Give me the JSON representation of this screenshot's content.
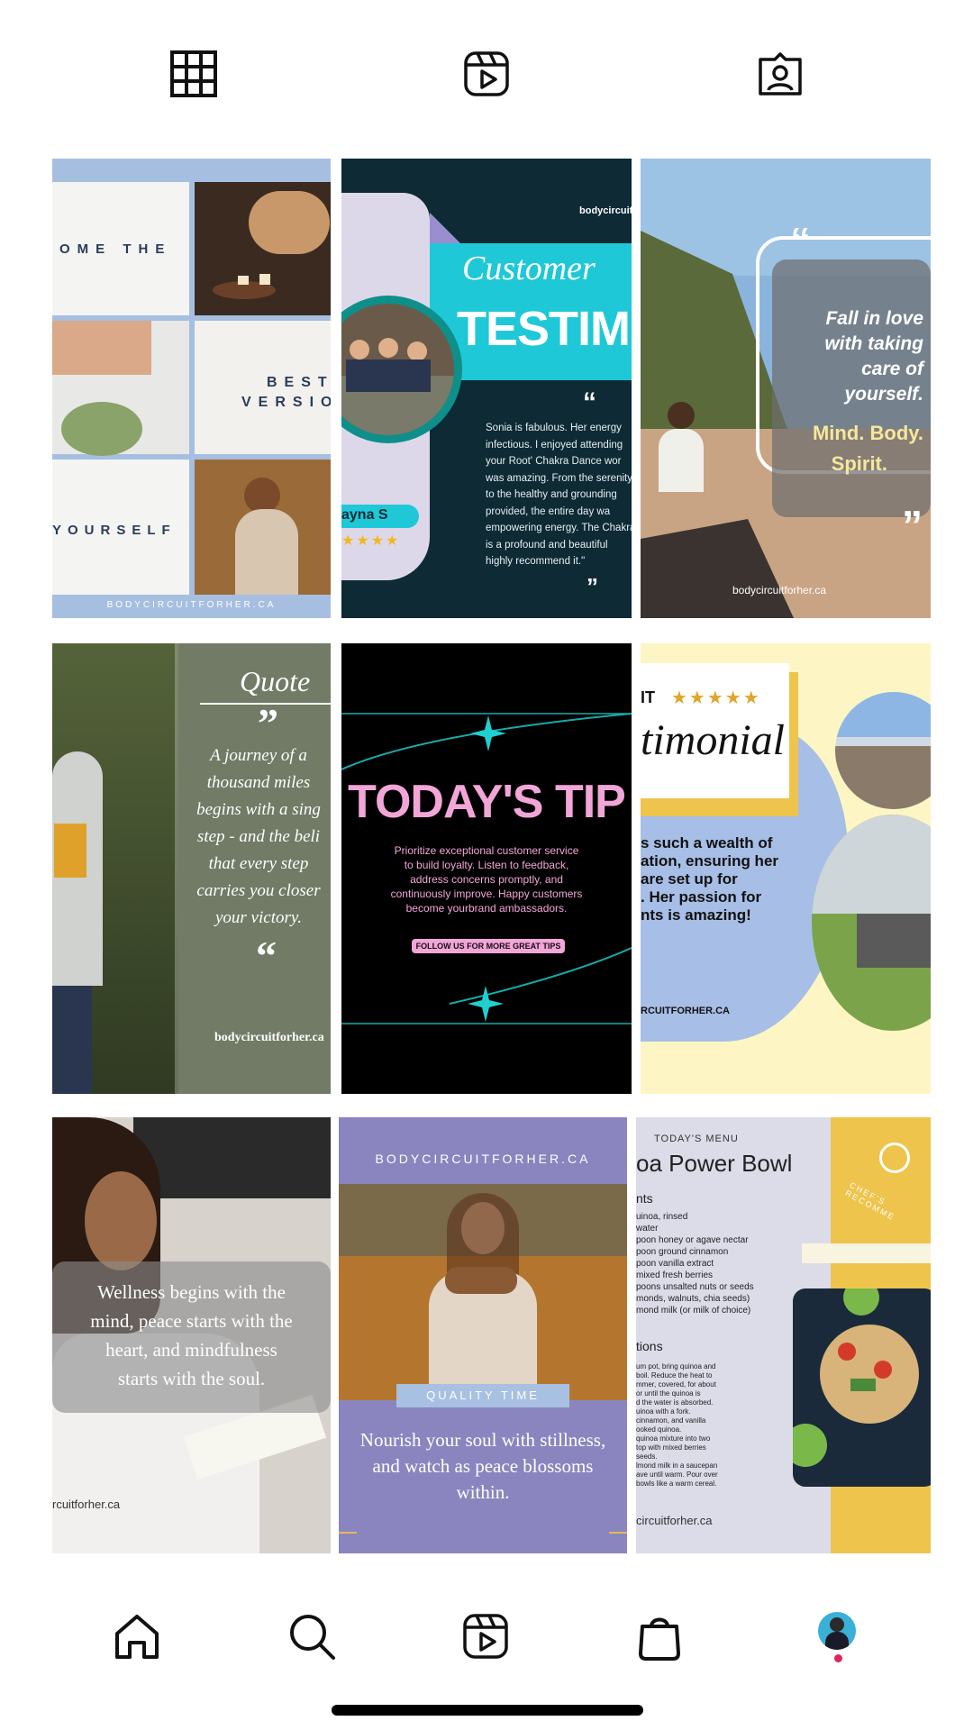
{
  "top_tabs": [
    {
      "icon": "grid-icon"
    },
    {
      "icon": "reels-icon"
    },
    {
      "icon": "tagged-icon"
    }
  ],
  "posts": {
    "p1": {
      "words": [
        "OME THE",
        "BEST",
        "VERSIO",
        "YOURSELF"
      ],
      "footer": "BODYCIRCUITFORHER.CA"
    },
    "p2": {
      "brand": "bodycircuitf",
      "script": "Customer",
      "title": "TESTIMONI",
      "quote_open": "“",
      "body_lines": [
        "Sonia is fabulous. Her energy",
        "infectious. I enjoyed attending",
        "your Root' Chakra Dance wor",
        "was amazing. From the serenity",
        "to the healthy and grounding",
        "provided, the entire day wa",
        "empowering energy. The Chakra",
        "is a profound and beautiful",
        "highly recommend it.\""
      ],
      "quote_close": "”",
      "name": "ayna S",
      "stars": "★★★★"
    },
    "p3": {
      "line1": "Fall in love",
      "line2": "with taking",
      "line3": "care of",
      "line4": "yourself.",
      "accent1": "Mind. Body.",
      "accent2": "Spirit.",
      "brand": "bodycircuitforher.ca"
    },
    "p4": {
      "heading": "Quote",
      "quote_open": "”",
      "lines": [
        "A journey of a",
        "thousand miles",
        "begins with a sing",
        "step - and the beli",
        "that every step",
        "carries you closer",
        "your victory."
      ],
      "quote_close": "“",
      "brand": "bodycircuitforher.ca"
    },
    "p5": {
      "title": "TODAY'S TIP",
      "body_lines": [
        "Prioritize exceptional customer service",
        "to build loyalty. Listen to feedback,",
        "address concerns promptly, and",
        "continuously improve. Happy customers",
        "become yourbrand ambassadors."
      ],
      "cta": "FOLLOW US FOR MORE GREAT TIPS"
    },
    "p6": {
      "top": "IT",
      "stars": "★★★★★",
      "script": "timonial",
      "body_lines": [
        "s such a wealth of",
        "ation, ensuring her",
        "are set up for",
        ". Her passion for",
        "nts is amazing!"
      ],
      "brand": "RCUITFORHER.CA"
    },
    "p7": {
      "lines": [
        "Wellness begins with the",
        "mind, peace starts with the",
        "heart, and mindfulness",
        "starts with the soul."
      ],
      "brand": "rcuitforher.ca"
    },
    "p8": {
      "brand": "BODYCIRCUITFORHER.CA",
      "tag": "QUALITY TIME",
      "lines": [
        "Nourish your soul with stillness,",
        "and watch as peace blossoms",
        "within."
      ]
    },
    "p9": {
      "eyebrow": "TODAY'S MENU",
      "title": "oa Power Bowl",
      "ingredients_heading": "nts",
      "ingredients": [
        "uinoa, rinsed",
        "water",
        "poon honey or agave nectar",
        "poon ground cinnamon",
        "poon vanilla extract",
        "mixed fresh berries",
        "poons unsalted nuts or seeds",
        "monds, walnuts, chia seeds)",
        "mond milk (or milk of choice)"
      ],
      "instructions_heading": "tions",
      "instructions": [
        "um pot, bring quinoa and",
        "boil. Reduce the heat to",
        "mmer, covered, for about",
        "or until the quinoa is",
        "d the water is absorbed.",
        "uinoa with a fork.",
        "cinnamon, and vanilla",
        "ooked quinoa.",
        "quinoa mixture into two",
        "top with mixed berries",
        "seeds.",
        "lmond milk in a saucepan",
        "ave until warm. Pour over",
        "bowls like a warm cereal."
      ],
      "badge": "CHEF'S RECOMME",
      "brand": "circuitforher.ca"
    }
  },
  "bottom_nav": [
    {
      "icon": "home-icon"
    },
    {
      "icon": "search-icon"
    },
    {
      "icon": "reels-icon"
    },
    {
      "icon": "shop-icon"
    },
    {
      "icon": "profile-avatar"
    }
  ],
  "colors": {
    "accent_teal": "#1fc8d6",
    "pink": "#f2a6d8",
    "purple": "#8a85bf",
    "yellow": "#f1c75a",
    "notification_dot": "#e0245e"
  }
}
